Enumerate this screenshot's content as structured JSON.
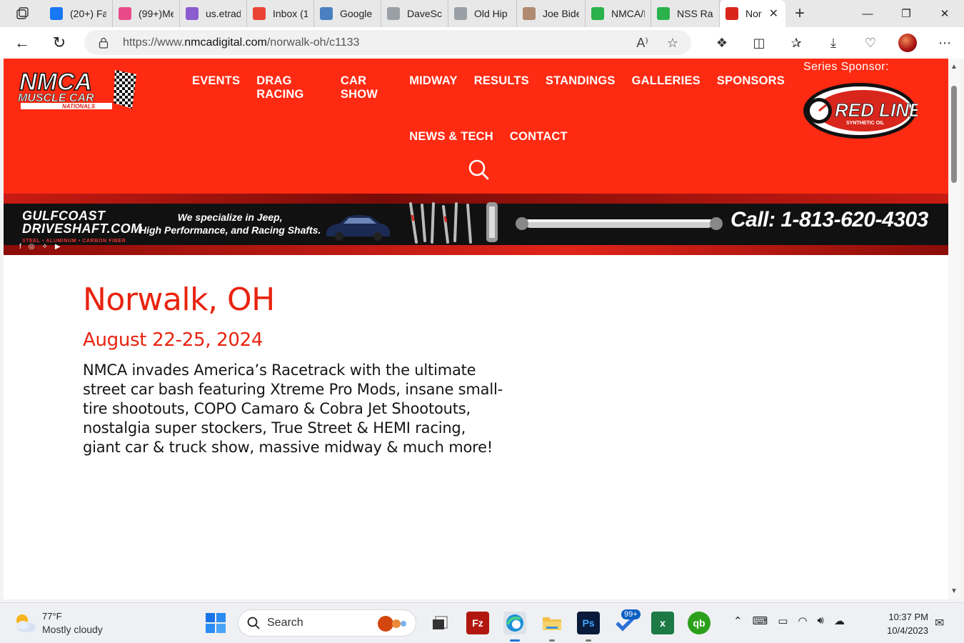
{
  "browser": {
    "tabs": [
      {
        "title": "(20+) Fa",
        "icon": "facebook-icon",
        "color": "#1877f2"
      },
      {
        "title": "(99+)Me",
        "icon": "dots-icon",
        "color": "#e94b8a"
      },
      {
        "title": "us.etrad",
        "icon": "etrade-icon",
        "color": "#8a5cd0"
      },
      {
        "title": "Inbox (1",
        "icon": "gmail-icon",
        "color": "#ea4335"
      },
      {
        "title": "Google",
        "icon": "google-docs-icon",
        "color": "#4a7fc1"
      },
      {
        "title": "DaveSch",
        "icon": "ghost-icon",
        "color": "#9aa0a6"
      },
      {
        "title": "Old Hip",
        "icon": "ghost-icon",
        "color": "#9aa0a6"
      },
      {
        "title": "Joe Bide",
        "icon": "photo-icon",
        "color": "#b08a70"
      },
      {
        "title": "NMCA/I",
        "icon": "thumb-icon",
        "color": "#2bb24c"
      },
      {
        "title": "NSS Rac",
        "icon": "thumb-icon",
        "color": "#2bb24c"
      },
      {
        "title": "Nor",
        "icon": "checkered-flag-icon",
        "color": "#d9261c"
      }
    ],
    "new_tab": "+",
    "url_prefix": "https://www.",
    "url_domain": "nmcadigital.com",
    "url_path": "/norwalk-oh/c1133"
  },
  "site": {
    "logo_line1": "NMCA",
    "logo_line2": "MUSCLE CAR",
    "logo_line3": "NATIONALS",
    "nav_row1": [
      "EVENTS",
      "DRAG RACING",
      "CAR SHOW",
      "MIDWAY",
      "RESULTS",
      "STANDINGS",
      "GALLERIES",
      "SPONSORS"
    ],
    "nav_row2": [
      "NEWS & TECH",
      "CONTACT"
    ],
    "sponsor_label": "Series Sponsor:",
    "sponsor_name": "RED LINE",
    "sponsor_sub": "SYNTHETIC OIL",
    "banner": {
      "brand_line1": "GULFCOAST",
      "brand_line2": "DRIVESHAFT.COM",
      "brand_sub": "STEEL • ALUMINUM • CARBON FIBER",
      "tag_line1": "We specialize in Jeep,",
      "tag_line2": "High Performance, and Racing Shafts.",
      "call": "Call: 1-813-620-4303"
    },
    "page_title": "Norwalk, OH",
    "date": "August 22-25, 2024",
    "description": "NMCA invades America’s Racetrack with the ultimate street car bash featuring Xtreme Pro Mods, insane small-tire shootouts, COPO Camaro & Cobra Jet Shootouts, nostalgia super stockers, True Street & HEMI racing, giant car & truck show, massive midway & much more!"
  },
  "taskbar": {
    "temperature": "77°F",
    "condition": "Mostly cloudy",
    "search_placeholder": "Search",
    "badge": "99+",
    "time": "10:37 PM",
    "date": "10/4/2023"
  },
  "colors": {
    "brand_red": "#ff2a12",
    "heading_red": "#e8230f"
  }
}
